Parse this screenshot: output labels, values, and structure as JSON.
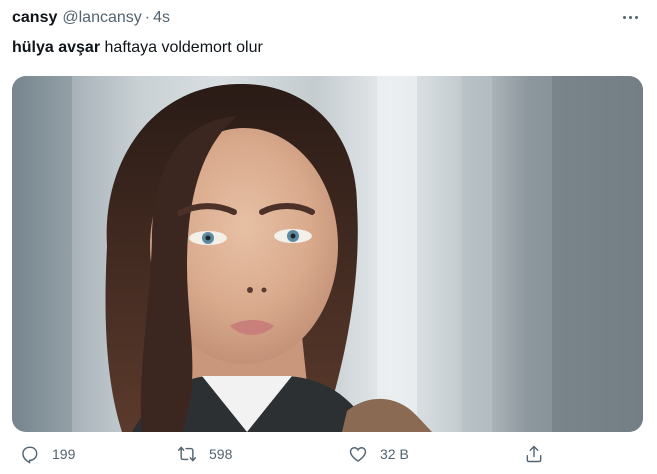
{
  "tweet": {
    "display_name": "cansy",
    "handle": "@lancansy",
    "separator": "·",
    "time": "4s",
    "text_bold": "hülya avşar",
    "text_rest": "haftaya voldemort olur"
  },
  "actions": {
    "reply_count": "199",
    "retweet_count": "598",
    "like_count": "32 B"
  },
  "icons": [
    "more-icon",
    "reply-icon",
    "retweet-icon",
    "like-icon",
    "share-icon"
  ]
}
